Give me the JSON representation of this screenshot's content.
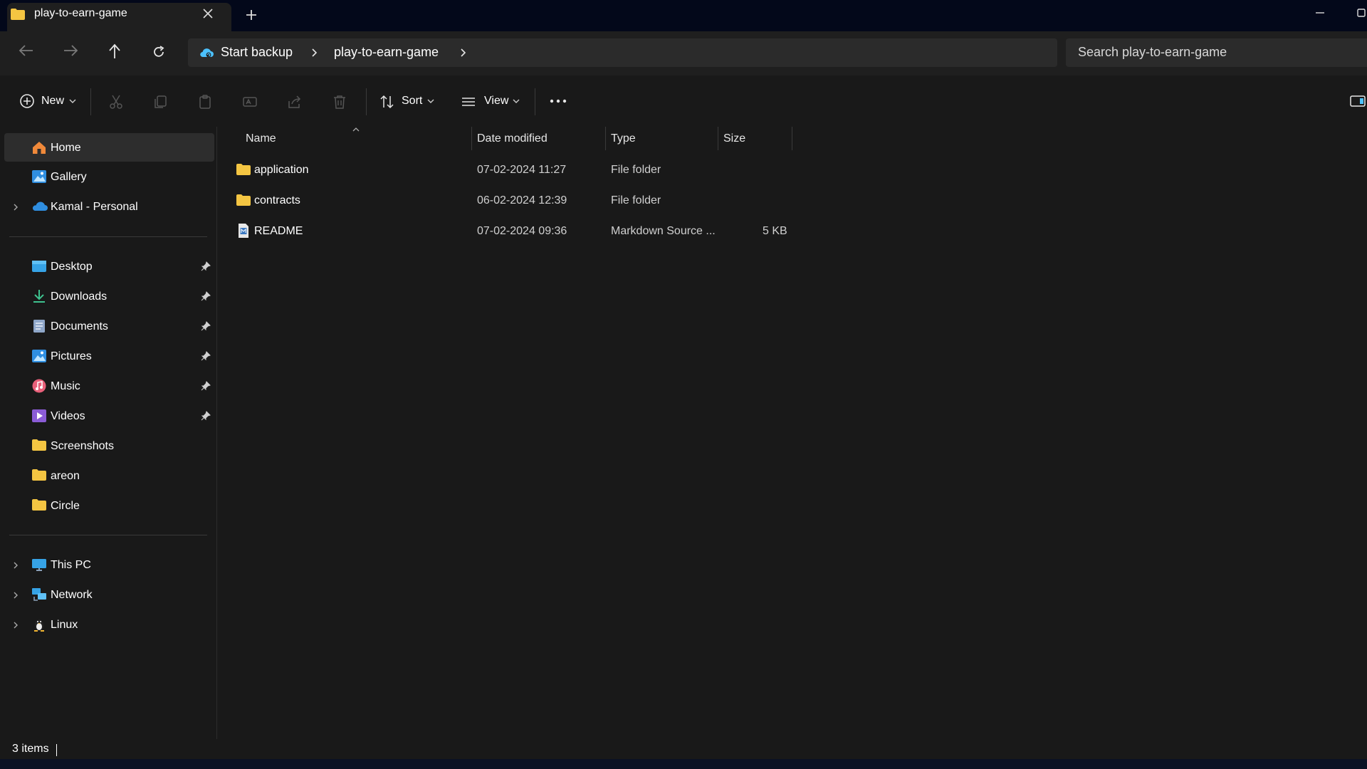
{
  "tab": {
    "title": "play-to-earn-game"
  },
  "address": {
    "breadcrumbs": [
      "Start backup",
      "play-to-earn-game"
    ]
  },
  "search": {
    "placeholder": "Search play-to-earn-game"
  },
  "toolbar": {
    "new_label": "New",
    "sort_label": "Sort",
    "view_label": "View"
  },
  "sidebar": {
    "top": [
      {
        "label": "Home",
        "icon": "home-icon"
      },
      {
        "label": "Gallery",
        "icon": "gallery-icon"
      },
      {
        "label": "Kamal - Personal",
        "icon": "onedrive-cloud-icon"
      }
    ],
    "quick_access": [
      {
        "label": "Desktop",
        "icon": "desktop-icon"
      },
      {
        "label": "Downloads",
        "icon": "downloads-icon"
      },
      {
        "label": "Documents",
        "icon": "documents-icon"
      },
      {
        "label": "Pictures",
        "icon": "pictures-icon"
      },
      {
        "label": "Music",
        "icon": "music-icon"
      },
      {
        "label": "Videos",
        "icon": "videos-icon"
      },
      {
        "label": "Screenshots",
        "icon": "folder-icon"
      },
      {
        "label": "areon",
        "icon": "folder-icon"
      },
      {
        "label": "Circle",
        "icon": "folder-icon"
      }
    ],
    "locations": [
      {
        "label": "This PC",
        "icon": "pc-icon"
      },
      {
        "label": "Network",
        "icon": "network-icon"
      },
      {
        "label": "Linux",
        "icon": "linux-penguin-icon"
      }
    ]
  },
  "columns": [
    "Name",
    "Date modified",
    "Type",
    "Size"
  ],
  "files": [
    {
      "name": "application",
      "date": "07-02-2024 11:27",
      "type": "File folder",
      "size": "",
      "icon": "folder-icon"
    },
    {
      "name": "contracts",
      "date": "06-02-2024 12:39",
      "type": "File folder",
      "size": "",
      "icon": "folder-icon"
    },
    {
      "name": "README",
      "date": "07-02-2024 09:36",
      "type": "Markdown Source ...",
      "size": "5 KB",
      "icon": "markdown-file-icon"
    }
  ],
  "status": {
    "item_count": "3 items"
  },
  "colors": {
    "folder": "#f4c542",
    "accent": "#4cc2ff",
    "background": "#191919",
    "titlebar": "#03081a"
  }
}
